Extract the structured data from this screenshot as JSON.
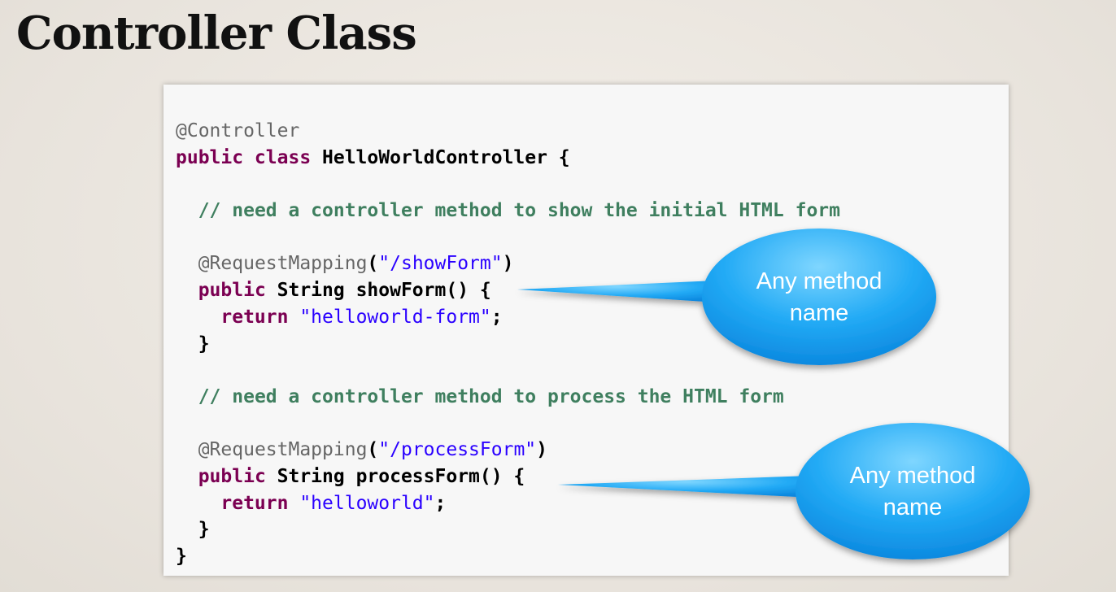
{
  "slide": {
    "title": "Controller Class"
  },
  "code": {
    "line1_annotation": "@Controller",
    "line2_keywords": "public class ",
    "line2_classname": "HelloWorldController {",
    "line4_comment": "// need a controller method to show the initial HTML form",
    "line6_annotation": "@RequestMapping",
    "line6_open": "(",
    "line6_path": "\"/showForm\"",
    "line6_close": ")",
    "line7_keyword": "public ",
    "line7_signature": "String showForm() {",
    "line8_keyword": "return ",
    "line8_value": "\"helloworld-form\"",
    "line8_end": ";",
    "line9_brace": "}",
    "line11_comment": "// need a controller method to process the HTML form",
    "line13_annotation": "@RequestMapping",
    "line13_open": "(",
    "line13_path": "\"/processForm\"",
    "line13_close": ")",
    "line14_keyword": "public ",
    "line14_signature": "String processForm() {",
    "line15_keyword": "return ",
    "line15_value": "\"helloworld\"",
    "line15_end": ";",
    "line16_brace": "}",
    "line17_brace": "}"
  },
  "callouts": {
    "first": "Any method name",
    "second": "Any method name"
  },
  "colors": {
    "bubble_light": "#66ccff",
    "bubble_dark": "#0a8fe6",
    "annotation": "#666666",
    "keyword": "#7b0052",
    "comment": "#3f7f5f",
    "string": "#2a00ff"
  }
}
